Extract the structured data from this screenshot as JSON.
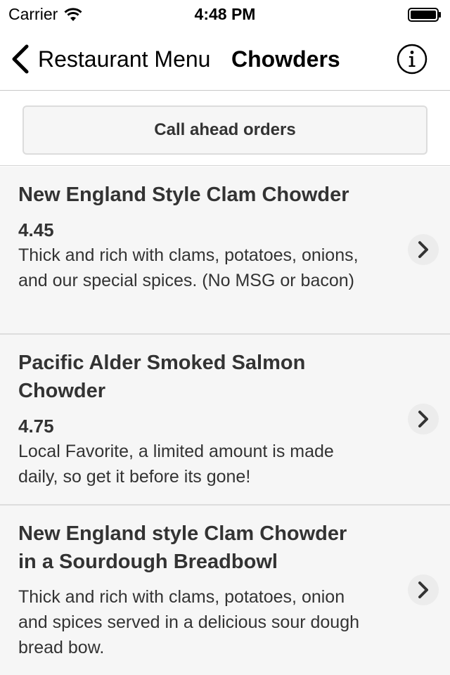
{
  "status_bar": {
    "carrier": "Carrier",
    "time": "4:48 PM"
  },
  "nav": {
    "back_label": "Restaurant Menu",
    "title": "Chowders",
    "info_icon": "info-icon"
  },
  "call_button": {
    "label": "Call ahead orders"
  },
  "items": [
    {
      "name": "New England Style Clam Chowder",
      "price": "4.45",
      "description": "Thick and rich with clams, potatoes, onions, and our special spices. (No MSG or bacon)"
    },
    {
      "name": "Pacific Alder Smoked Salmon Chowder",
      "price": "4.75",
      "description": "Local Favorite, a limited amount is made daily, so get it before its gone!"
    },
    {
      "name": "New England style Clam Chowder in a Sourdough Breadbowl",
      "description": "Thick and rich with clams, potatoes, onion and spices served in a delicious sour dough bread bow."
    }
  ],
  "colors": {
    "text": "#333333",
    "item_bg": "#f6f6f6",
    "divider": "#dddddd"
  }
}
